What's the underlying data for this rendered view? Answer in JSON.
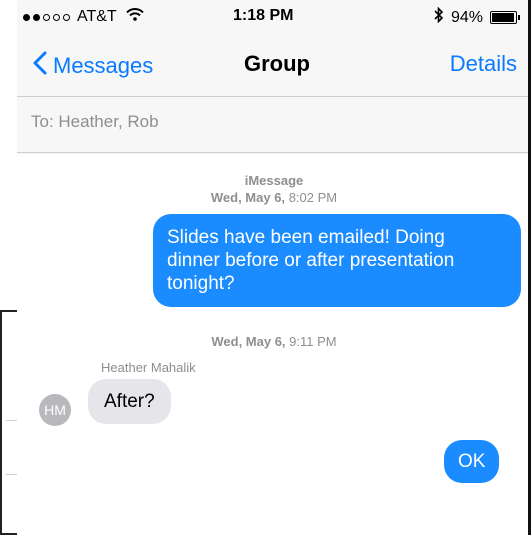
{
  "status_bar": {
    "carrier": "AT&T",
    "time": "1:18 PM",
    "battery": "94%",
    "battery_level": 0.94,
    "signal_bars": 2,
    "signal_max": 5
  },
  "nav": {
    "back_label": "Messages",
    "title": "Group",
    "details_label": "Details"
  },
  "recipient_line": "To: Heather, Rob",
  "thread": {
    "meta1": {
      "service": "iMessage",
      "date": "Wed, May 6,",
      "time": "8:02 PM"
    },
    "msg1": "Slides have been emailed! Doing dinner before or after presentation tonight?",
    "msg1_lines": [
      "Slides have been emailed! Doing",
      "dinner before or after presentation",
      "tonight?"
    ],
    "meta2": {
      "date": "Wed, May 6,",
      "time": "9:11 PM"
    },
    "sender": "Heather Mahalik",
    "avatar_initials": "HM",
    "msg2": "After?",
    "msg3": "OK"
  },
  "colors": {
    "accent": "#0a7aff",
    "outgoing_bubble": "#1a8cff",
    "incoming_bubble": "#e5e5ea",
    "meta_text": "#8e8e93",
    "chrome_bg": "#f7f7f7"
  },
  "background_fragment": {
    "char": "3"
  }
}
